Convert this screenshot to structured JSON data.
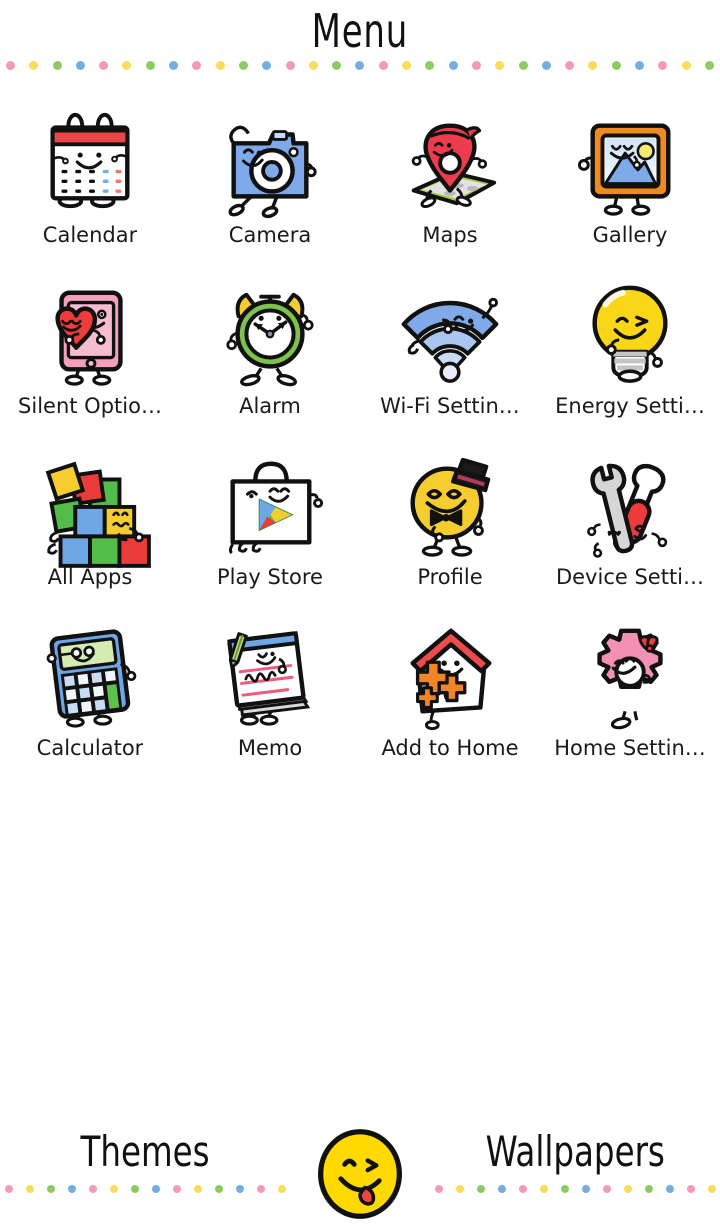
{
  "header": {
    "title": "Menu"
  },
  "theme": {
    "background": "#ffffff",
    "text": "#1a1a1a",
    "dot_colors": [
      "#f49ab4",
      "#fadb5a",
      "#8dcc63",
      "#74aee0"
    ],
    "accent_pink": "#f49ab4",
    "accent_yellow": "#fadb5a",
    "accent_green": "#8dcc63",
    "accent_blue": "#74aee0",
    "smiley_yellow": "#ffd900",
    "outline": "#111111"
  },
  "grid": {
    "columns": 4,
    "items": [
      {
        "icon": "calendar-icon",
        "label": "Calendar"
      },
      {
        "icon": "camera-icon",
        "label": "Camera"
      },
      {
        "icon": "maps-pin-icon",
        "label": "Maps"
      },
      {
        "icon": "gallery-picture-icon",
        "label": "Gallery"
      },
      {
        "icon": "silent-options-icon",
        "label": "Silent Optio…"
      },
      {
        "icon": "alarm-clock-icon",
        "label": "Alarm"
      },
      {
        "icon": "wifi-icon",
        "label": "Wi-Fi Settin…"
      },
      {
        "icon": "lightbulb-icon",
        "label": "Energy Setti…"
      },
      {
        "icon": "all-apps-blocks-icon",
        "label": "All Apps"
      },
      {
        "icon": "play-store-bag-icon",
        "label": "Play Store"
      },
      {
        "icon": "profile-face-icon",
        "label": "Profile"
      },
      {
        "icon": "device-tools-icon",
        "label": "Device Setti…"
      },
      {
        "icon": "calculator-icon",
        "label": "Calculator"
      },
      {
        "icon": "memo-notepad-icon",
        "label": "Memo"
      },
      {
        "icon": "add-to-home-icon",
        "label": "Add to Home"
      },
      {
        "icon": "home-settings-gear-icon",
        "label": "Home Settin…"
      }
    ]
  },
  "footer": {
    "left_label": "Themes",
    "right_label": "Wallpapers",
    "center_icon": "winking-smiley-icon"
  }
}
